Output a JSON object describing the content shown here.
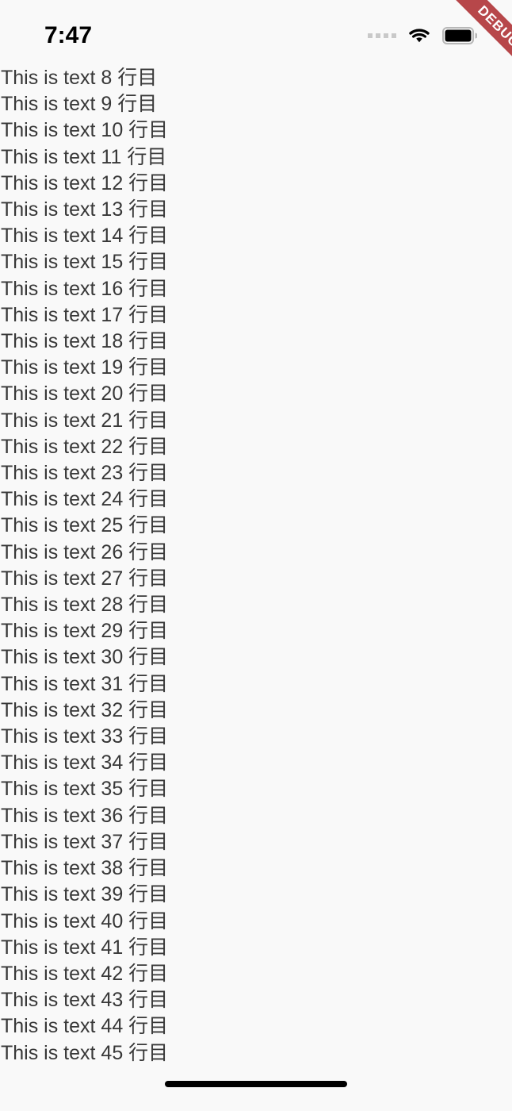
{
  "status_bar": {
    "time": "7:47",
    "signal_icon": "signal-dots-icon",
    "wifi_icon": "wifi-icon",
    "battery_icon": "battery-full-icon",
    "battery_level_percent": 100
  },
  "debug_banner": {
    "label": "DEBUG",
    "color": "#b7474a",
    "text_color": "#ffffff",
    "position": "top-right-diagonal"
  },
  "colors": {
    "background": "#f9f9f9",
    "text": "#383838",
    "time_text": "#000000",
    "signal_dots": "#c9c9c9",
    "home_indicator": "#000000"
  },
  "content": {
    "first_visible_line_number": 8,
    "last_visible_line_number": 45,
    "lines": [
      "This is text 8 行目",
      "This is text 9 行目",
      "This is text 10 行目",
      "This is text 11 行目",
      "This is text 12 行目",
      "This is text 13 行目",
      "This is text 14 行目",
      "This is text 15 行目",
      "This is text 16 行目",
      "This is text 17 行目",
      "This is text 18 行目",
      "This is text 19 行目",
      "This is text 20 行目",
      "This is text 21 行目",
      "This is text 22 行目",
      "This is text 23 行目",
      "This is text 24 行目",
      "This is text 25 行目",
      "This is text 26 行目",
      "This is text 27 行目",
      "This is text 28 行目",
      "This is text 29 行目",
      "This is text 30 行目",
      "This is text 31 行目",
      "This is text 32 行目",
      "This is text 33 行目",
      "This is text 34 行目",
      "This is text 35 行目",
      "This is text 36 行目",
      "This is text 37 行目",
      "This is text 38 行目",
      "This is text 39 行目",
      "This is text 40 行目",
      "This is text 41 行目",
      "This is text 42 行目",
      "This is text 43 行目",
      "This is text 44 行目",
      "This is text 45 行目"
    ]
  },
  "home_indicator": {
    "name": "home-indicator"
  }
}
